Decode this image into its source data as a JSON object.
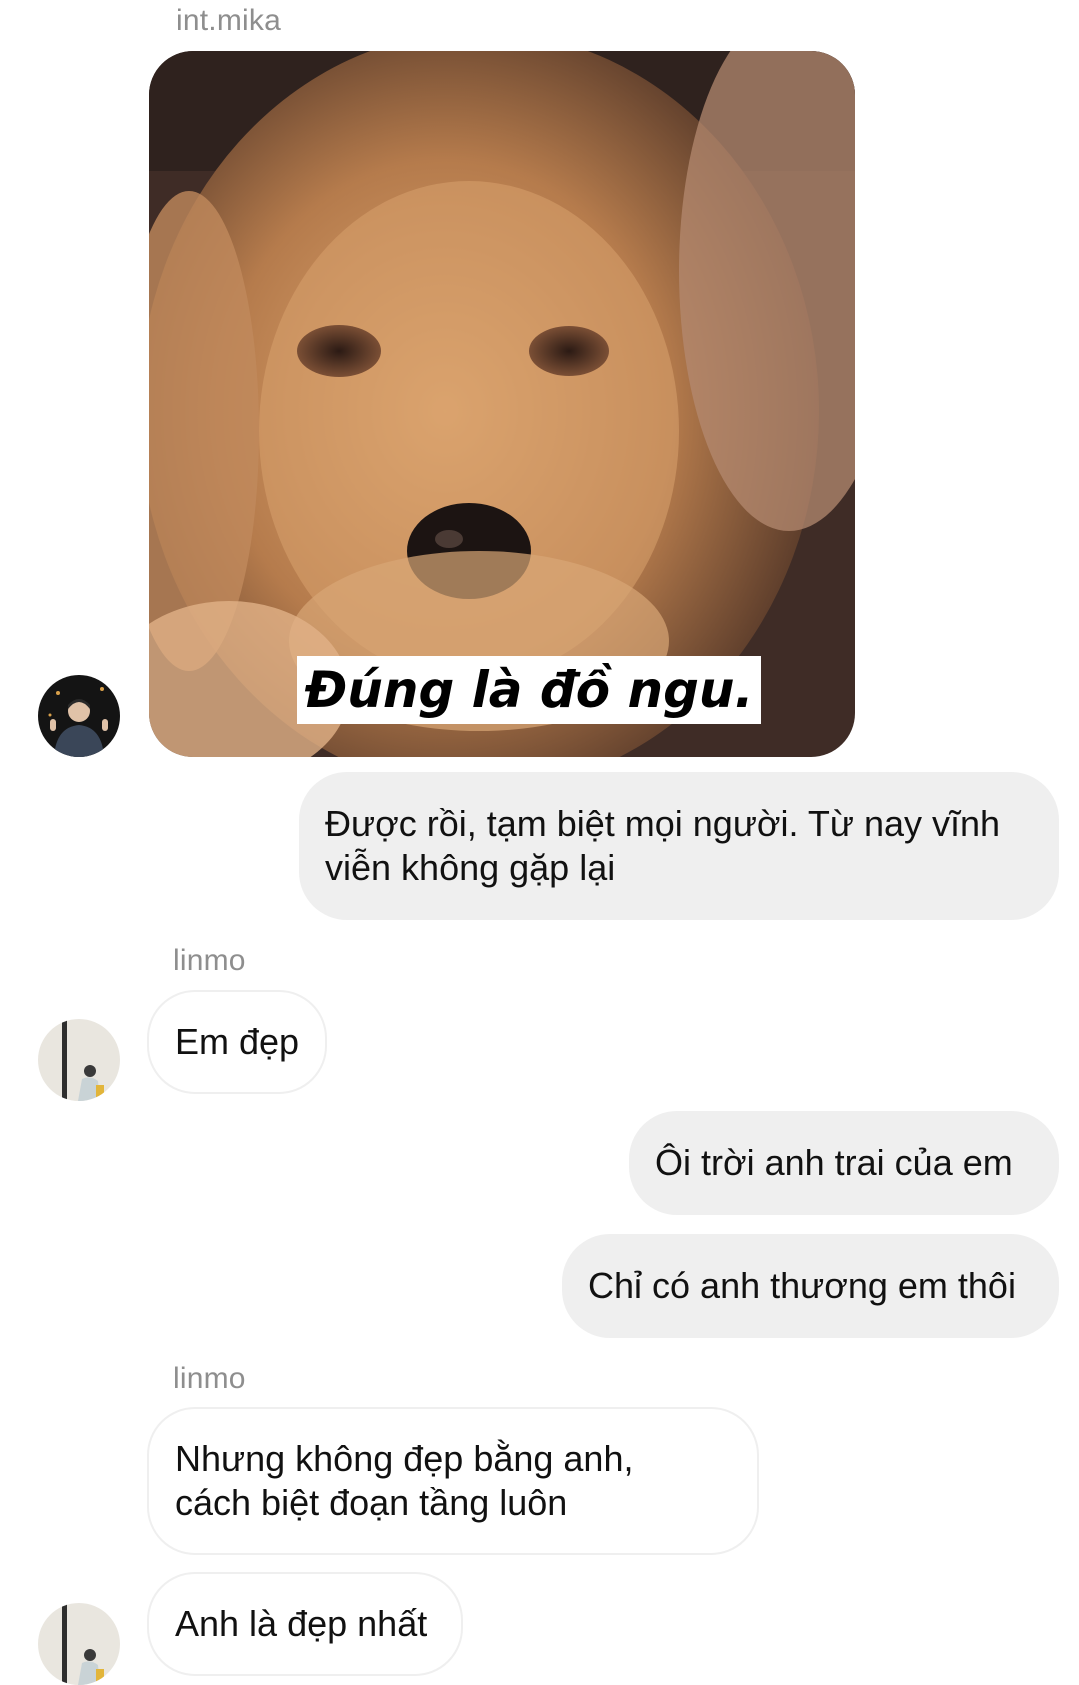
{
  "messages": {
    "sender_mika": "int.mika",
    "meme_caption": "Đúng là đồ ngu.",
    "out_1_line1": "Được rồi, tạm biệt mọi người. Từ nay vĩnh",
    "out_1_line2": "viễn không gặp lại",
    "sender_linmo_1": "linmo",
    "in_1": "Em đẹp",
    "out_2": "Ôi trời anh trai của em",
    "out_3": "Chỉ có anh thương em thôi",
    "sender_linmo_2": "linmo",
    "in_2_line1": "Nhưng không đẹp bằng anh,",
    "in_2_line2": "cách biệt đoạn tầng luôn",
    "in_3": "Anh là đẹp nhất"
  },
  "colors": {
    "incoming_border": "#efefef",
    "outgoing_bg": "#efefef",
    "sender_text": "#8e8e8e",
    "message_text": "#111111"
  }
}
